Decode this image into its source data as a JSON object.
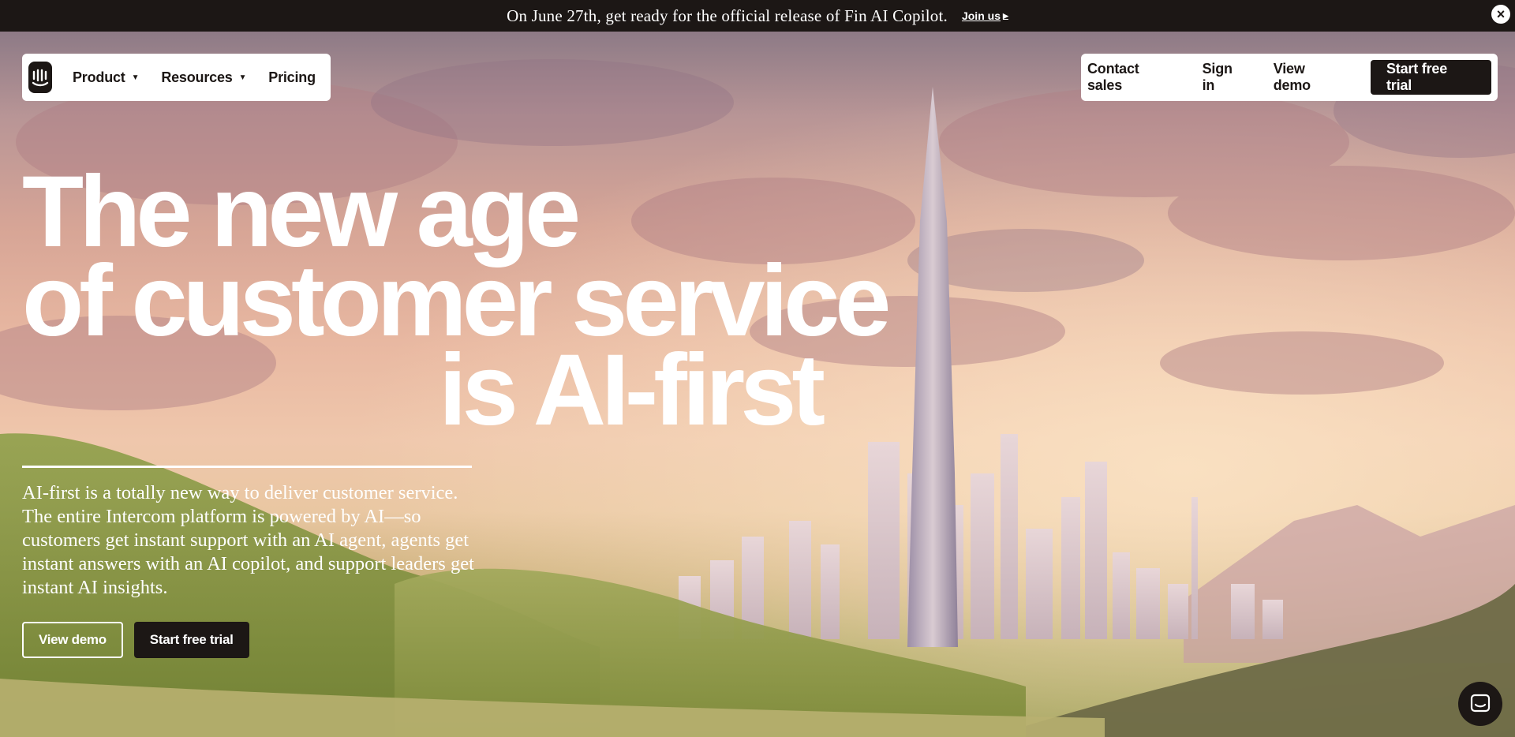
{
  "announcement": {
    "text": "On June 27th, get ready for the official release of Fin AI Copilot.",
    "link_label": "Join us",
    "close_icon": "close-icon"
  },
  "nav": {
    "logo_icon": "intercom-logo",
    "items": [
      {
        "label": "Product",
        "has_dropdown": true
      },
      {
        "label": "Resources",
        "has_dropdown": true
      },
      {
        "label": "Pricing",
        "has_dropdown": false
      }
    ],
    "right": {
      "contact_sales": "Contact sales",
      "sign_in": "Sign in",
      "view_demo": "View demo",
      "start_trial": "Start free trial"
    }
  },
  "hero": {
    "headline_lines": [
      "The new age",
      "of customer service",
      "is AI-first"
    ],
    "subtext": "AI-first is a totally new way to deliver customer service. The entire Intercom platform is powered by AI—so customers get instant support with an AI agent, agents get instant answers with an AI copilot, and support leaders get instant AI insights.",
    "cta_view_demo": "View demo",
    "cta_start_trial": "Start free trial"
  },
  "messenger": {
    "icon": "chat-bubble-icon"
  },
  "colors": {
    "dark": "#1c1715",
    "white": "#ffffff"
  }
}
